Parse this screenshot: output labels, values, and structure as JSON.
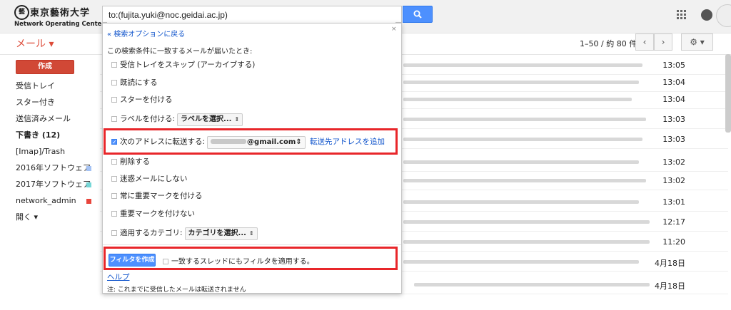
{
  "header": {
    "logo_seal": "藝",
    "logo_jp": "東京藝術大学",
    "logo_en": "Network Operating Center",
    "search_value": "to:(fujita.yuki@noc.geidai.ac.jp)"
  },
  "toolbar": {
    "mail_label": "メール ▾",
    "pager_text": "1–50 / 約 80 件",
    "prev": "‹",
    "next": "›",
    "gear": "⚙ ▾"
  },
  "sidebar": {
    "compose": "作成",
    "items": [
      {
        "label": "受信トレイ"
      },
      {
        "label": "スター付き"
      },
      {
        "label": "送信済みメール"
      },
      {
        "label": "下書き (12)"
      },
      {
        "label": "[Imap]/Trash"
      },
      {
        "label": "2016年ソフトウェア",
        "color": "#a4c2f4"
      },
      {
        "label": "2017年ソフトウェア",
        "color": "#76d7d7"
      },
      {
        "label": "network_admin",
        "color": "#e8453c"
      },
      {
        "label": "開く ▾"
      }
    ]
  },
  "mail_times": [
    "13:05",
    "13:04",
    "13:04",
    "13:03",
    "13:03",
    "13:02",
    "13:02",
    "13:01",
    "12:17",
    "11:20",
    "4月18日",
    "4月18日"
  ],
  "filter": {
    "close": "×",
    "back_link": "« 検索オプションに戻る",
    "criteria": "この検索条件に一致するメールが届いたとき:",
    "options": {
      "skip_inbox": "受信トレイをスキップ (アーカイブする)",
      "mark_read": "既読にする",
      "star": "スターを付ける",
      "apply_label": "ラベルを付ける:",
      "label_select": "ラベルを選択...",
      "forward": "次のアドレスに転送する:",
      "forward_addr": "@gmail.com",
      "add_forward": "転送先アドレスを追加",
      "delete": "削除する",
      "never_spam": "迷惑メールにしない",
      "always_important": "常に重要マークを付ける",
      "never_important": "重要マークを付けない",
      "category": "適用するカテゴリ:",
      "category_select": "カテゴリを選択..."
    },
    "create_button": "フィルタを作成",
    "apply_threads": "一致するスレッドにもフィルタを適用する。",
    "help": "ヘルプ",
    "note": "注: これまでに受信したメールは転送されません"
  },
  "colors": {
    "accent_red": "#dd4b39",
    "highlight": "#e8262a",
    "button_blue": "#4d90fe"
  }
}
